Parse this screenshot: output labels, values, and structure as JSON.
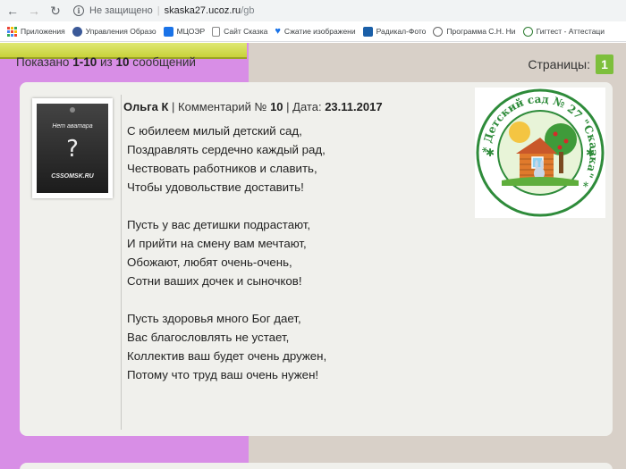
{
  "browser": {
    "security_label": "Не защищено",
    "url_host": "skaska27.ucoz.ru",
    "url_path": "/gb",
    "bookmarks": [
      {
        "label": "Приложения",
        "icon": "apps-grid-icon"
      },
      {
        "label": "Управления Образо",
        "icon": "bookmark-icon",
        "color": "#3b5998"
      },
      {
        "label": "МЦОЭР",
        "icon": "bookmark-icon",
        "color": "#1a73e8"
      },
      {
        "label": "Сайт Сказка",
        "icon": "page-icon",
        "color": "#888888"
      },
      {
        "label": "Сжатие изображени",
        "icon": "heart-icon",
        "color": "#1a73e8"
      },
      {
        "label": "Радикал-Фото",
        "icon": "bookmark-icon",
        "color": "#1a5fa8"
      },
      {
        "label": "Программа С.Н. Ни",
        "icon": "globe-icon",
        "color": "#666666"
      },
      {
        "label": "Гигтест - Аттестаци",
        "icon": "check-circle-icon",
        "color": "#2e7d32"
      }
    ]
  },
  "guestbook": {
    "shown_prefix": "Показано",
    "shown_range": "1-10",
    "shown_mid": "из",
    "shown_total": "10",
    "shown_suffix": "сообщений",
    "pages_label": "Страницы:",
    "current_page": "1"
  },
  "comment": {
    "author": "Ольга К",
    "comment_label": "Комментарий №",
    "comment_number": "10",
    "date_label": "Дата:",
    "date": "23.11.2017",
    "text": "С юбилеем милый детский сад,\nПоздравлять сердечно каждый рад,\nЧествовать работников и славить,\nЧтобы удовольствие доставить!\n\nПусть у вас детишки подрастают,\nИ прийти на смену вам мечтают,\nОбожают, любят очень-очень,\nСотни ваших дочек и сыночков!\n\nПусть здоровья много Бог дает,\nВас благословлять не устает,\nКоллектив ваш будет очень дружен,\nПотому что труд ваш очень нужен!",
    "avatar_text_top": "Нет аватара",
    "avatar_symbol": "?",
    "avatar_site": "CSSOMSK.RU"
  },
  "logo": {
    "ring_text": "* Детский сад № 27 \"Сказка\" *",
    "colors": {
      "ring": "#2e8b3a",
      "sun": "#f4c542",
      "house": "#e07a2c"
    }
  }
}
